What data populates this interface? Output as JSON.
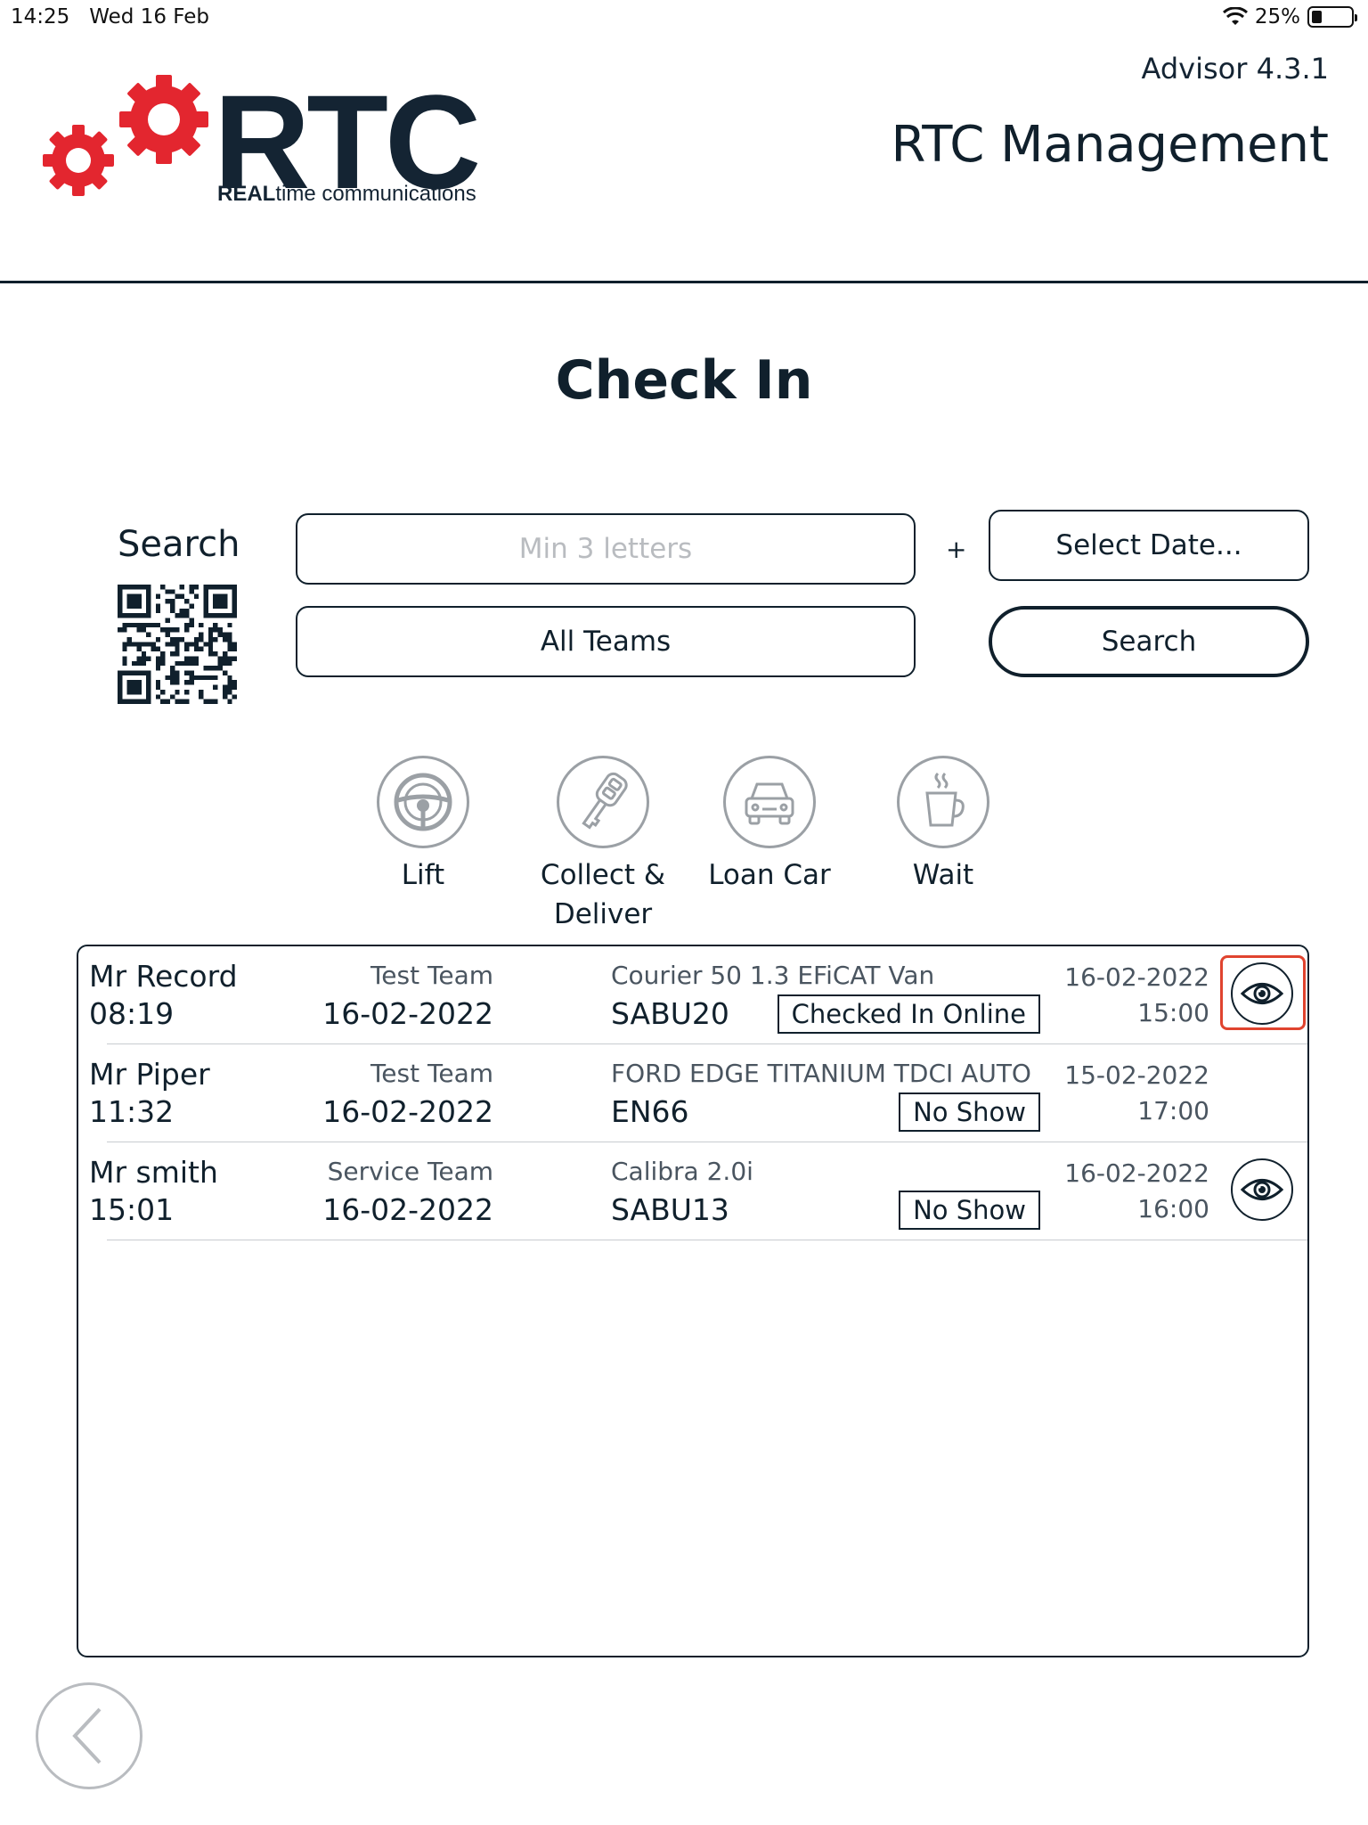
{
  "status_bar": {
    "time": "14:25",
    "date": "Wed 16 Feb",
    "battery": "25%",
    "battery_level": 0.25
  },
  "header": {
    "logo_text": "RTC",
    "logo_sub_bold": "REAL",
    "logo_sub_rest": "time communications",
    "version": "Advisor 4.3.1",
    "company": "RTC Management"
  },
  "page": {
    "title": "Check In"
  },
  "search": {
    "label": "Search",
    "input_placeholder": "Min 3 letters",
    "plus": "+",
    "date_button": "Select Date...",
    "team_select": "All Teams",
    "search_button": "Search"
  },
  "services": [
    {
      "label": "Lift",
      "icon": "steering-wheel-icon"
    },
    {
      "label": "Collect &\nDeliver",
      "icon": "car-key-icon"
    },
    {
      "label": "Loan Car",
      "icon": "car-icon"
    },
    {
      "label": "Wait",
      "icon": "coffee-cup-icon"
    }
  ],
  "bookings": [
    {
      "name": "Mr Record",
      "time": "08:19",
      "team": "Test Team",
      "date": "16-02-2022",
      "vehicle": "Courier 50 1.3 EFiCAT Van",
      "reg": "SABU20",
      "status": "Checked In Online",
      "appt_date": "16-02-2022",
      "appt_time": "15:00",
      "has_view": true,
      "selected": true
    },
    {
      "name": "Mr Piper",
      "time": "11:32",
      "team": "Test Team",
      "date": "16-02-2022",
      "vehicle": "FORD EDGE TITANIUM TDCI AUTO",
      "reg": "EN66",
      "status": "No Show",
      "appt_date": "15-02-2022",
      "appt_time": "17:00",
      "has_view": false,
      "selected": false
    },
    {
      "name": "Mr smith",
      "time": "15:01",
      "team": "Service Team",
      "date": "16-02-2022",
      "vehicle": "Calibra 2.0i",
      "reg": "SABU13",
      "status": "No Show",
      "appt_date": "16-02-2022",
      "appt_time": "16:00",
      "has_view": true,
      "selected": false
    }
  ],
  "colors": {
    "brand_red": "#e3262f",
    "navy": "#10202c",
    "highlight": "#e0442f"
  }
}
